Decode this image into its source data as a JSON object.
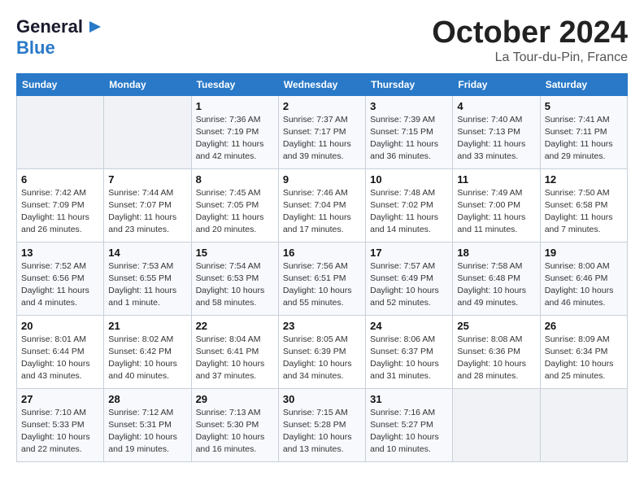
{
  "header": {
    "logo_line1": "General",
    "logo_line2": "Blue",
    "month": "October 2024",
    "location": "La Tour-du-Pin, France"
  },
  "days_of_week": [
    "Sunday",
    "Monday",
    "Tuesday",
    "Wednesday",
    "Thursday",
    "Friday",
    "Saturday"
  ],
  "weeks": [
    [
      {
        "day": "",
        "sunrise": "",
        "sunset": "",
        "daylight": "",
        "empty": true
      },
      {
        "day": "",
        "sunrise": "",
        "sunset": "",
        "daylight": "",
        "empty": true
      },
      {
        "day": "1",
        "sunrise": "Sunrise: 7:36 AM",
        "sunset": "Sunset: 7:19 PM",
        "daylight": "Daylight: 11 hours and 42 minutes."
      },
      {
        "day": "2",
        "sunrise": "Sunrise: 7:37 AM",
        "sunset": "Sunset: 7:17 PM",
        "daylight": "Daylight: 11 hours and 39 minutes."
      },
      {
        "day": "3",
        "sunrise": "Sunrise: 7:39 AM",
        "sunset": "Sunset: 7:15 PM",
        "daylight": "Daylight: 11 hours and 36 minutes."
      },
      {
        "day": "4",
        "sunrise": "Sunrise: 7:40 AM",
        "sunset": "Sunset: 7:13 PM",
        "daylight": "Daylight: 11 hours and 33 minutes."
      },
      {
        "day": "5",
        "sunrise": "Sunrise: 7:41 AM",
        "sunset": "Sunset: 7:11 PM",
        "daylight": "Daylight: 11 hours and 29 minutes."
      }
    ],
    [
      {
        "day": "6",
        "sunrise": "Sunrise: 7:42 AM",
        "sunset": "Sunset: 7:09 PM",
        "daylight": "Daylight: 11 hours and 26 minutes."
      },
      {
        "day": "7",
        "sunrise": "Sunrise: 7:44 AM",
        "sunset": "Sunset: 7:07 PM",
        "daylight": "Daylight: 11 hours and 23 minutes."
      },
      {
        "day": "8",
        "sunrise": "Sunrise: 7:45 AM",
        "sunset": "Sunset: 7:05 PM",
        "daylight": "Daylight: 11 hours and 20 minutes."
      },
      {
        "day": "9",
        "sunrise": "Sunrise: 7:46 AM",
        "sunset": "Sunset: 7:04 PM",
        "daylight": "Daylight: 11 hours and 17 minutes."
      },
      {
        "day": "10",
        "sunrise": "Sunrise: 7:48 AM",
        "sunset": "Sunset: 7:02 PM",
        "daylight": "Daylight: 11 hours and 14 minutes."
      },
      {
        "day": "11",
        "sunrise": "Sunrise: 7:49 AM",
        "sunset": "Sunset: 7:00 PM",
        "daylight": "Daylight: 11 hours and 11 minutes."
      },
      {
        "day": "12",
        "sunrise": "Sunrise: 7:50 AM",
        "sunset": "Sunset: 6:58 PM",
        "daylight": "Daylight: 11 hours and 7 minutes."
      }
    ],
    [
      {
        "day": "13",
        "sunrise": "Sunrise: 7:52 AM",
        "sunset": "Sunset: 6:56 PM",
        "daylight": "Daylight: 11 hours and 4 minutes."
      },
      {
        "day": "14",
        "sunrise": "Sunrise: 7:53 AM",
        "sunset": "Sunset: 6:55 PM",
        "daylight": "Daylight: 11 hours and 1 minute."
      },
      {
        "day": "15",
        "sunrise": "Sunrise: 7:54 AM",
        "sunset": "Sunset: 6:53 PM",
        "daylight": "Daylight: 10 hours and 58 minutes."
      },
      {
        "day": "16",
        "sunrise": "Sunrise: 7:56 AM",
        "sunset": "Sunset: 6:51 PM",
        "daylight": "Daylight: 10 hours and 55 minutes."
      },
      {
        "day": "17",
        "sunrise": "Sunrise: 7:57 AM",
        "sunset": "Sunset: 6:49 PM",
        "daylight": "Daylight: 10 hours and 52 minutes."
      },
      {
        "day": "18",
        "sunrise": "Sunrise: 7:58 AM",
        "sunset": "Sunset: 6:48 PM",
        "daylight": "Daylight: 10 hours and 49 minutes."
      },
      {
        "day": "19",
        "sunrise": "Sunrise: 8:00 AM",
        "sunset": "Sunset: 6:46 PM",
        "daylight": "Daylight: 10 hours and 46 minutes."
      }
    ],
    [
      {
        "day": "20",
        "sunrise": "Sunrise: 8:01 AM",
        "sunset": "Sunset: 6:44 PM",
        "daylight": "Daylight: 10 hours and 43 minutes."
      },
      {
        "day": "21",
        "sunrise": "Sunrise: 8:02 AM",
        "sunset": "Sunset: 6:42 PM",
        "daylight": "Daylight: 10 hours and 40 minutes."
      },
      {
        "day": "22",
        "sunrise": "Sunrise: 8:04 AM",
        "sunset": "Sunset: 6:41 PM",
        "daylight": "Daylight: 10 hours and 37 minutes."
      },
      {
        "day": "23",
        "sunrise": "Sunrise: 8:05 AM",
        "sunset": "Sunset: 6:39 PM",
        "daylight": "Daylight: 10 hours and 34 minutes."
      },
      {
        "day": "24",
        "sunrise": "Sunrise: 8:06 AM",
        "sunset": "Sunset: 6:37 PM",
        "daylight": "Daylight: 10 hours and 31 minutes."
      },
      {
        "day": "25",
        "sunrise": "Sunrise: 8:08 AM",
        "sunset": "Sunset: 6:36 PM",
        "daylight": "Daylight: 10 hours and 28 minutes."
      },
      {
        "day": "26",
        "sunrise": "Sunrise: 8:09 AM",
        "sunset": "Sunset: 6:34 PM",
        "daylight": "Daylight: 10 hours and 25 minutes."
      }
    ],
    [
      {
        "day": "27",
        "sunrise": "Sunrise: 7:10 AM",
        "sunset": "Sunset: 5:33 PM",
        "daylight": "Daylight: 10 hours and 22 minutes."
      },
      {
        "day": "28",
        "sunrise": "Sunrise: 7:12 AM",
        "sunset": "Sunset: 5:31 PM",
        "daylight": "Daylight: 10 hours and 19 minutes."
      },
      {
        "day": "29",
        "sunrise": "Sunrise: 7:13 AM",
        "sunset": "Sunset: 5:30 PM",
        "daylight": "Daylight: 10 hours and 16 minutes."
      },
      {
        "day": "30",
        "sunrise": "Sunrise: 7:15 AM",
        "sunset": "Sunset: 5:28 PM",
        "daylight": "Daylight: 10 hours and 13 minutes."
      },
      {
        "day": "31",
        "sunrise": "Sunrise: 7:16 AM",
        "sunset": "Sunset: 5:27 PM",
        "daylight": "Daylight: 10 hours and 10 minutes."
      },
      {
        "day": "",
        "sunrise": "",
        "sunset": "",
        "daylight": "",
        "empty": true
      },
      {
        "day": "",
        "sunrise": "",
        "sunset": "",
        "daylight": "",
        "empty": true
      }
    ]
  ]
}
